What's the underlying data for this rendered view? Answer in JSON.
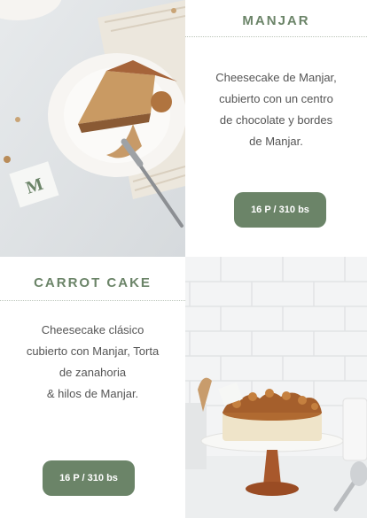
{
  "manjar": {
    "title": "MANJAR",
    "description_lines": [
      "Cheesecake de Manjar,",
      "cubierto con un centro",
      "de chocolate y bordes",
      "de Manjar."
    ],
    "price": "16 P / 310 bs",
    "photo_logo": "M"
  },
  "carrot": {
    "title": "CARROT CAKE",
    "description_lines": [
      "Cheesecake clásico",
      "cubierto con Manjar, Torta",
      "de zanahoria",
      "& hilos de Manjar."
    ],
    "price": "16 P / 310 bs"
  },
  "colors": {
    "accent": "#6b8468",
    "rule": "#b9c3b7",
    "text": "#555555"
  }
}
